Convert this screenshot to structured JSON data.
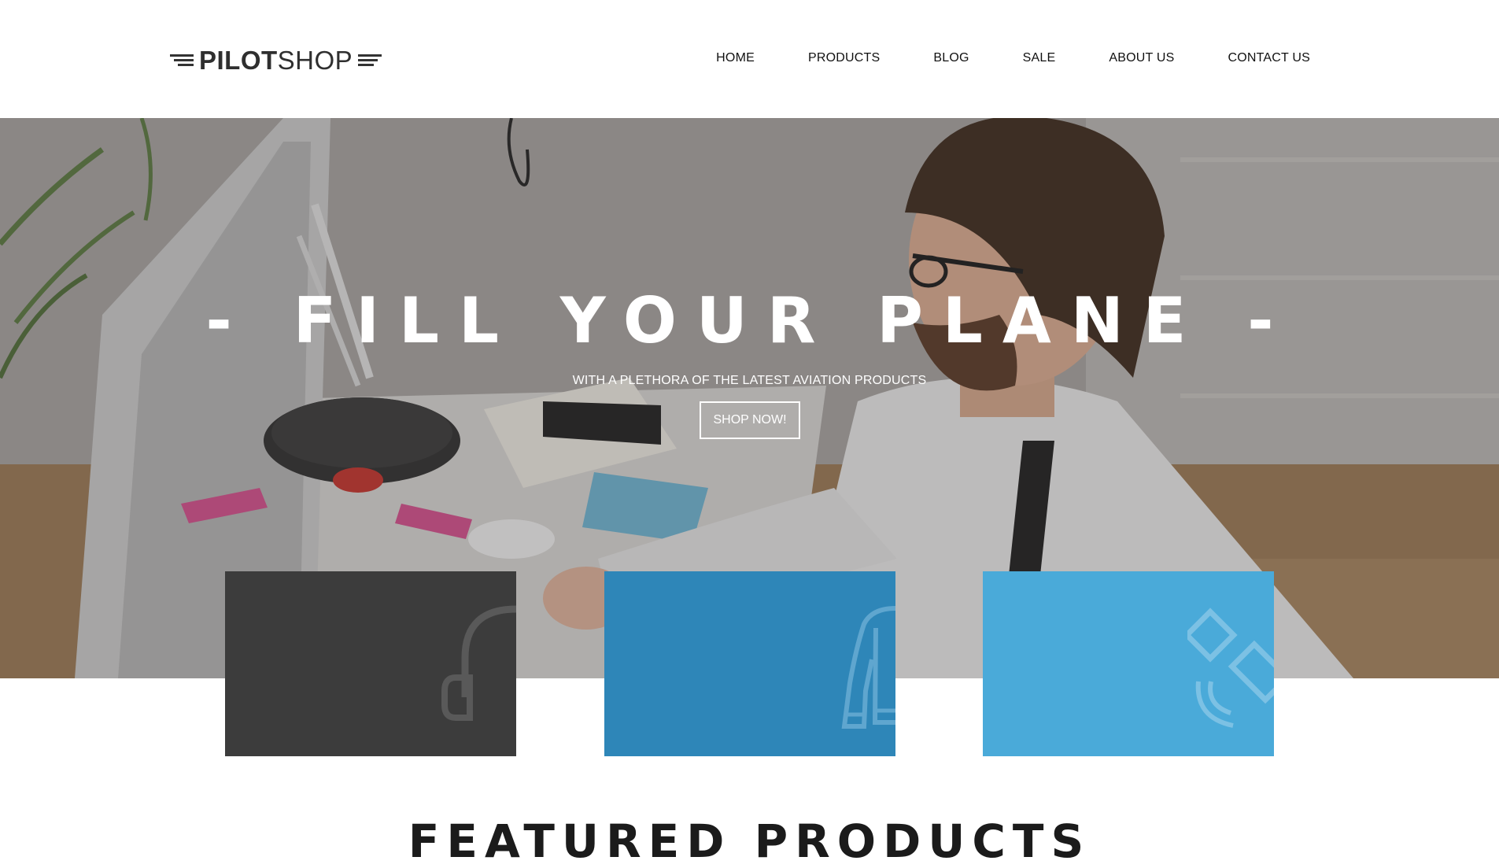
{
  "brand": {
    "name_bold": "PILOT",
    "name_light": "SHOP",
    "wing_icon": "wing-icon"
  },
  "nav": {
    "items": [
      {
        "label": "HOME"
      },
      {
        "label": "PRODUCTS"
      },
      {
        "label": "BLOG"
      },
      {
        "label": "SALE"
      },
      {
        "label": "ABOUT US"
      },
      {
        "label": "CONTACT US"
      }
    ]
  },
  "hero": {
    "title": "- FILL YOUR PLANE -",
    "subtitle": "WITH A PLETHORA OF THE LATEST AVIATION PRODUCTS",
    "cta_label": "SHOP NOW!"
  },
  "categories": [
    {
      "icon": "headset-icon",
      "color": "#3c3c3c"
    },
    {
      "icon": "jacket-icon",
      "color": "#2e86b8"
    },
    {
      "icon": "satellite-icon",
      "color": "#4aaad9"
    }
  ],
  "featured": {
    "heading": "FEATURED PRODUCTS"
  }
}
